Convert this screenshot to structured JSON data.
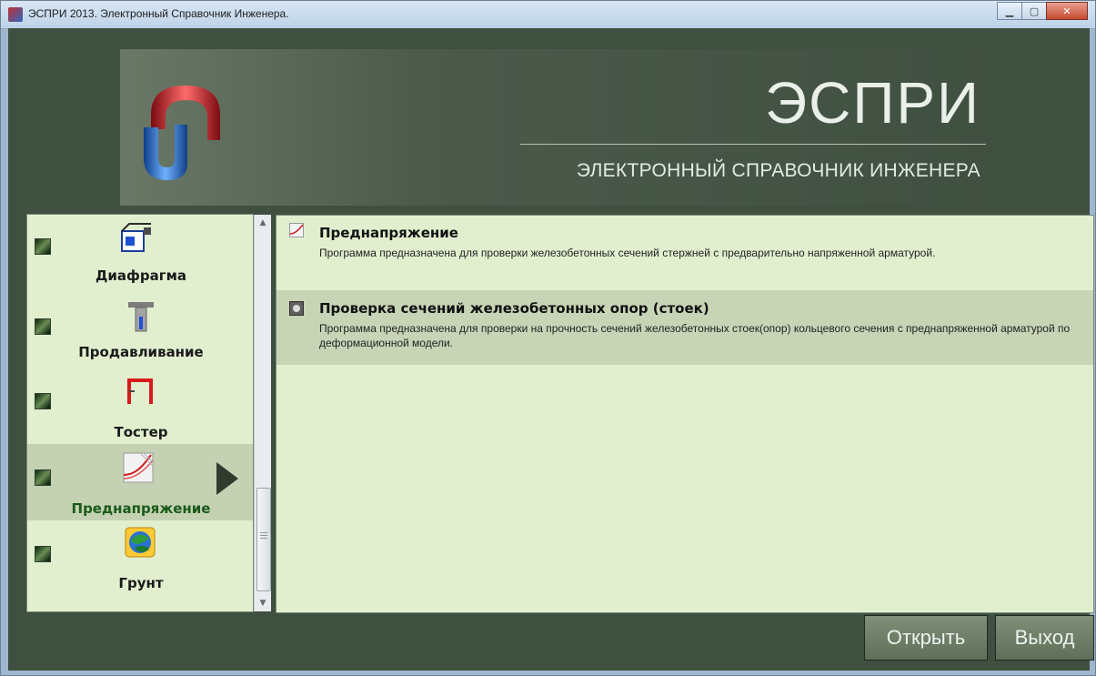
{
  "window": {
    "title": "ЭСПРИ 2013. Электронный Справочник Инженера.",
    "controls": [
      "minimize",
      "maximize",
      "close"
    ]
  },
  "header": {
    "brand": "ЭСПРИ",
    "subtitle": "ЭЛЕКТРОННЫЙ СПРАВОЧНИК ИНЖЕНЕРА"
  },
  "sidebar": {
    "items": [
      {
        "label": "Диафрагма",
        "icon": "diaphragm-icon"
      },
      {
        "label": "Продавливание",
        "icon": "punching-icon"
      },
      {
        "label": "Тостер",
        "icon": "frame-icon"
      },
      {
        "label": "Преднапряжение",
        "icon": "prestress-icon",
        "selected": true
      },
      {
        "label": "Грунт",
        "icon": "soil-icon"
      }
    ]
  },
  "main": {
    "entries": [
      {
        "title": "Преднапряжение",
        "desc": "Программа предназначена для проверки железобетонных сечений стержней с  предварительно напряженной арматурой."
      },
      {
        "title": "Проверка сечений железобетонных опор (стоек)",
        "desc": "Программа предназначена для проверки на прочность сечений железобетонных стоек(опор) кольцевого сечения с преднапряженной арматурой по деформационной модели.",
        "selected": true
      }
    ]
  },
  "buttons": {
    "open": "Открыть",
    "exit": "Выход"
  },
  "colors": {
    "background": "#3f4f40",
    "panel": "#e2efcf",
    "selection": "#c7d4b6"
  }
}
